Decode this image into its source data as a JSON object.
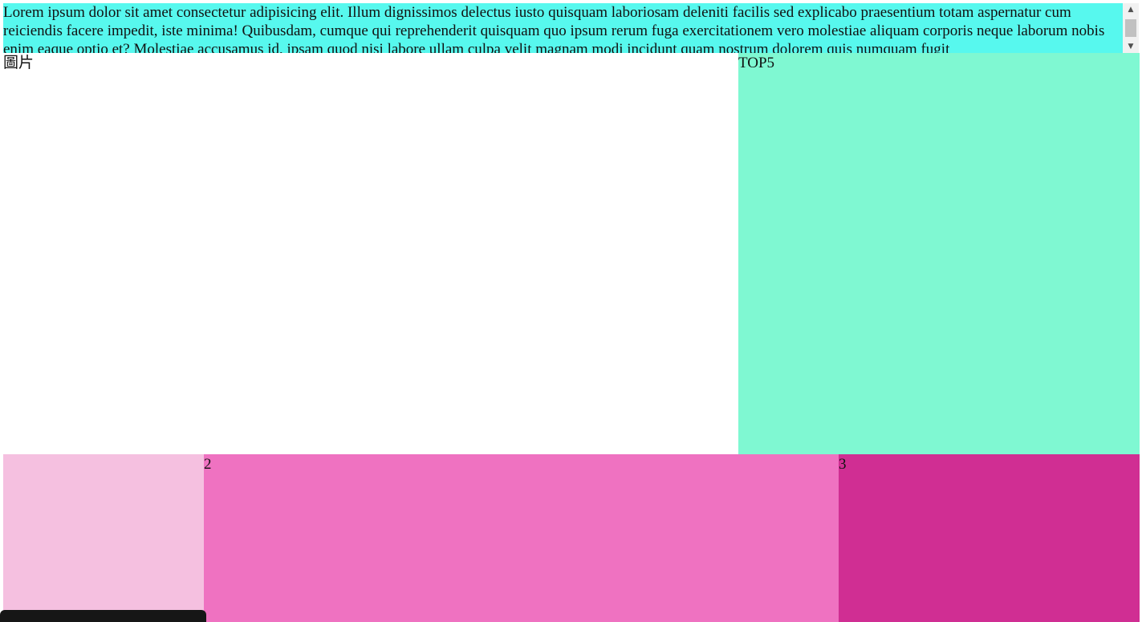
{
  "header": {
    "text": "Lorem ipsum dolor sit amet consectetur adipisicing elit. Illum dignissimos delectus iusto quisquam laboriosam deleniti facilis sed explicabo praesentium totam aspernatur cum reiciendis facere impedit, iste minima! Quibusdam, cumque qui reprehenderit quisquam quo ipsum rerum fuga exercitationem vero molestiae aliquam corporis neque laborum nobis enim eaque optio et? Molestiae accusamus id, ipsam quod nisi labore ullam culpa velit magnam modi incidunt quam nostrum dolorem quis numquam fugit",
    "background": "#57f8ee",
    "scroll_up_icon": "▲",
    "scroll_down_icon": "▼"
  },
  "image_area": {
    "label": "圖片"
  },
  "top5": {
    "label": "TOP5",
    "background": "#7ff8d2"
  },
  "cards": [
    {
      "label": "",
      "background": "#f5c0e0"
    },
    {
      "label": "2",
      "background": "#ef72c1"
    },
    {
      "label": "3",
      "background": "#d02e93"
    }
  ]
}
